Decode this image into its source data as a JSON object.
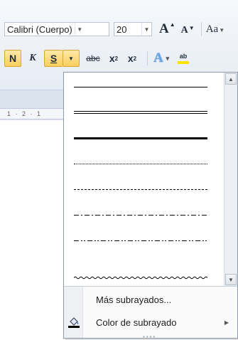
{
  "ribbon": {
    "font_name": "Calibri (Cuerpo)",
    "font_size": "20",
    "grow_font": "A",
    "shrink_font": "A",
    "change_case": "Aa",
    "bold": "N",
    "italic": "K",
    "underline": "S",
    "strikethrough": "abc",
    "subscript": "x",
    "subscript_mark": "2",
    "superscript": "x",
    "superscript_mark": "2",
    "text_effects": "A",
    "highlight": "ab"
  },
  "ruler": {
    "marks": "1 · 2 · 1"
  },
  "dropdown": {
    "menu_items": [
      {
        "label": "Más subrayados..."
      },
      {
        "label": "Color de subrayado"
      }
    ]
  },
  "colors": {
    "active_button": "#f9cf5c",
    "highlight_yellow": "#ffe400",
    "ribbon_bg": "#e6ecf4"
  }
}
